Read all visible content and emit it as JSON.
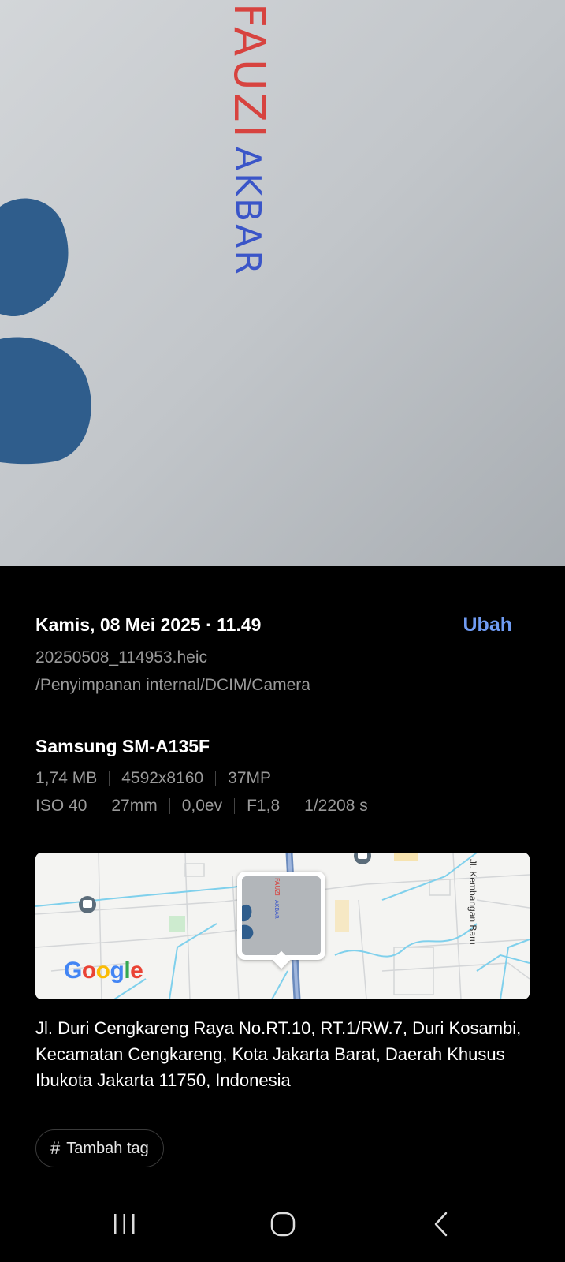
{
  "photo": {
    "handwriting_line1": "FAUZI",
    "handwriting_line2": "AKBAR"
  },
  "details": {
    "datetime": "Kamis, 08 Mei 2025 · 11.49",
    "edit_label": "Ubah",
    "filename": "20250508_114953.heic",
    "path": "/Penyimpanan internal/DCIM/Camera",
    "device": "Samsung SM-A135F",
    "file_specs": [
      "1,74 MB",
      "4592x8160",
      "37MP"
    ],
    "camera_specs": [
      "ISO 40",
      "27mm",
      "0,0ev",
      "F1,8",
      "1/2208 s"
    ]
  },
  "map": {
    "street_label": "Jl. Kembangan Baru",
    "logo_text": "Google",
    "logo_colors": [
      "#4285F4",
      "#EA4335",
      "#FBBC05",
      "#4285F4",
      "#34A853",
      "#EA4335"
    ]
  },
  "address": "Jl. Duri Cengkareng Raya No.RT.10, RT.1/RW.7, Duri Kosambi, Kecamatan Cengkareng, Kota Jakarta Barat, Daerah Khusus Ibukota Jakarta 11750, Indonesia",
  "tag_button": {
    "icon": "#",
    "label": "Tambah tag"
  },
  "navbar": {
    "icons": [
      "recent-apps-icon",
      "home-icon",
      "back-icon"
    ]
  },
  "colors": {
    "accent": "#6f9bf2",
    "muted_text": "#9a9a9a",
    "background": "#000000"
  }
}
